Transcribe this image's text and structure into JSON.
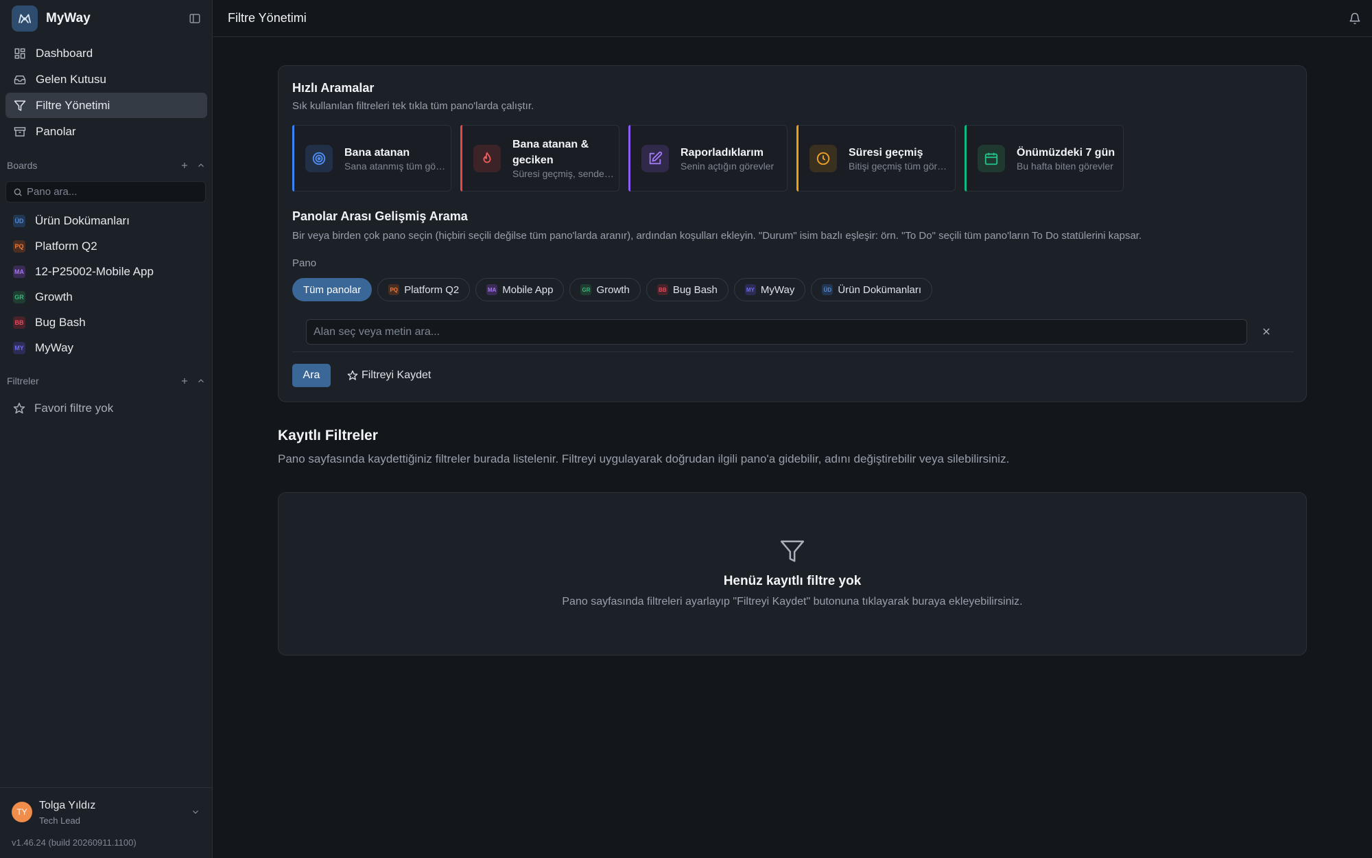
{
  "brand": {
    "name": "MyWay"
  },
  "nav": [
    {
      "label": "Dashboard",
      "icon": "grid-icon"
    },
    {
      "label": "Gelen Kutusu",
      "icon": "inbox-icon"
    },
    {
      "label": "Filtre Yönetimi",
      "icon": "filter-icon",
      "active": true
    },
    {
      "label": "Panolar",
      "icon": "archive-icon"
    }
  ],
  "boards_section": {
    "label": "Boards",
    "search_placeholder": "Pano ara...",
    "items": [
      {
        "code": "ÜD",
        "label": "Ürün Dokümanları",
        "color": "#4f8bd6",
        "bg": "#223754"
      },
      {
        "code": "PQ",
        "label": "Platform Q2",
        "color": "#f07a3a",
        "bg": "#4a2e22"
      },
      {
        "code": "MA",
        "label": "12-P25002-Mobile App",
        "color": "#a574f0",
        "bg": "#3a2c55"
      },
      {
        "code": "GR",
        "label": "Growth",
        "color": "#34b87a",
        "bg": "#1f3d31"
      },
      {
        "code": "BB",
        "label": "Bug Bash",
        "color": "#e34b5f",
        "bg": "#4a2229"
      },
      {
        "code": "MY",
        "label": "MyWay",
        "color": "#6f6cf0",
        "bg": "#2c2c57"
      }
    ]
  },
  "filters_section": {
    "label": "Filtreler",
    "empty_label": "Favori filtre yok"
  },
  "user": {
    "initials": "TY",
    "name": "Tolga Yıldız",
    "role": "Tech Lead",
    "version": "v1.46.24 (build 20260911.1100)"
  },
  "topbar": {
    "title": "Filtre Yönetimi"
  },
  "quick": {
    "title": "Hızlı Aramalar",
    "subtitle": "Sık kullanılan filtreleri tek tıkla tüm pano'larda çalıştır.",
    "items": [
      {
        "title": "Bana atanan",
        "desc": "Sana atanmış tüm görevler",
        "accent": "#3b82f6",
        "icon": "target-icon"
      },
      {
        "title": "Bana atanan & geciken",
        "desc": "Süresi geçmiş, sende olanlar",
        "accent": "#ef4444",
        "icon": "flame-icon"
      },
      {
        "title": "Raporladıklarım",
        "desc": "Senin açtığın görevler",
        "accent": "#8b5cf6",
        "icon": "edit-icon"
      },
      {
        "title": "Süresi geçmiş",
        "desc": "Bitişi geçmiş tüm görevler",
        "accent": "#f59e0b",
        "icon": "clock-icon"
      },
      {
        "title": "Önümüzdeki 7 gün",
        "desc": "Bu hafta biten görevler",
        "accent": "#10b981",
        "icon": "calendar-icon"
      }
    ]
  },
  "advanced": {
    "title": "Panolar Arası Gelişmiş Arama",
    "subtitle": "Bir veya birden çok pano seçin (hiçbiri seçili değilse tüm pano'larda aranır), ardından koşulları ekleyin. \"Durum\" isim bazlı eşleşir: örn. \"To Do\" seçili tüm pano'ların To Do statülerini kapsar.",
    "pano_label": "Pano",
    "chips": [
      {
        "label": "Tüm panolar",
        "active": true
      },
      {
        "code": "PQ",
        "label": "Platform Q2",
        "color": "#f07a3a",
        "bg": "#4a2e22"
      },
      {
        "code": "MA",
        "label": "Mobile App",
        "color": "#a574f0",
        "bg": "#3a2c55"
      },
      {
        "code": "GR",
        "label": "Growth",
        "color": "#34b87a",
        "bg": "#1f3d31"
      },
      {
        "code": "BB",
        "label": "Bug Bash",
        "color": "#e34b5f",
        "bg": "#4a2229"
      },
      {
        "code": "MY",
        "label": "MyWay",
        "color": "#6f6cf0",
        "bg": "#2c2c57"
      },
      {
        "code": "ÜD",
        "label": "Ürün Dokümanları",
        "color": "#4f8bd6",
        "bg": "#223754"
      }
    ],
    "input_placeholder": "Alan seç veya metin ara...",
    "search_button": "Ara",
    "save_button": "Filtreyi Kaydet"
  },
  "saved": {
    "title": "Kayıtlı Filtreler",
    "subtitle": "Pano sayfasında kaydettiğiniz filtreler burada listelenir. Filtreyi uygulayarak doğrudan ilgili pano'a gidebilir, adını değiştirebilir veya silebilirsiniz.",
    "empty_title": "Henüz kayıtlı filtre yok",
    "empty_subtitle": "Pano sayfasında filtreleri ayarlayıp \"Filtreyi Kaydet\" butonuna tıklayarak buraya ekleyebilirsiniz."
  }
}
